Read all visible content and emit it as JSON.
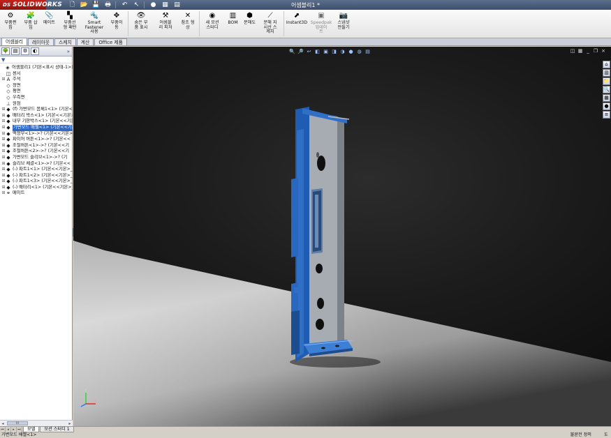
{
  "app": {
    "logo": "SOLIDWORKS",
    "logo_prefix": "DS",
    "doc_title": "어셈블리1 *"
  },
  "quick_access": [
    {
      "icon": "new-document-icon",
      "glyph": "🗋"
    },
    {
      "icon": "open-folder-icon",
      "glyph": "📂"
    },
    {
      "icon": "save-icon",
      "glyph": "💾"
    },
    {
      "icon": "print-icon",
      "glyph": "🖶"
    },
    {
      "icon": "undo-icon",
      "glyph": "↶"
    },
    {
      "icon": "select-arrow-icon",
      "glyph": "↖"
    },
    {
      "icon": "rebuild-icon",
      "glyph": "●"
    },
    {
      "icon": "file-properties-icon",
      "glyph": "▦"
    },
    {
      "icon": "options-icon",
      "glyph": "▤"
    }
  ],
  "ribbon": [
    {
      "id": "insert-component",
      "label": "부품편\n집",
      "icon": "component-edit-icon",
      "glyph": "⚙"
    },
    {
      "id": "insert-part",
      "label": "부품 삽\n입",
      "icon": "insert-component-icon",
      "glyph": "🧩"
    },
    {
      "id": "mate",
      "label": "메이트",
      "icon": "mate-icon",
      "glyph": "📎"
    },
    {
      "id": "linear-pattern",
      "label": "부품선\n형 패턴",
      "icon": "linear-pattern-icon",
      "glyph": "▚"
    },
    {
      "id": "smart-fastener",
      "label": "Smart\nFastener\n사용",
      "icon": "smart-fastener-icon",
      "glyph": "🔩"
    },
    {
      "id": "move-component",
      "label": "부품이\n동",
      "icon": "move-component-icon",
      "glyph": "✥"
    },
    {
      "id": "show-hidden",
      "label": "숨은 부\n품 표시",
      "icon": "show-hidden-icon",
      "glyph": "👁"
    },
    {
      "id": "assembly-features",
      "label": "어셈블\n리 피처",
      "icon": "assembly-feature-icon",
      "glyph": "⚒"
    },
    {
      "id": "reference-geometry",
      "label": "참조 형\n상",
      "icon": "reference-geometry-icon",
      "glyph": "✕"
    },
    {
      "id": "new-motion-study",
      "label": "새 모션\n스터디",
      "icon": "motion-study-icon",
      "glyph": "◉"
    },
    {
      "id": "bom",
      "label": "BOM",
      "icon": "bom-icon",
      "glyph": "▥"
    },
    {
      "id": "exploded-view",
      "label": "분해도",
      "icon": "exploded-view-icon",
      "glyph": "⬢"
    },
    {
      "id": "explode-line",
      "label": "분해 지\n시선 스\n케치",
      "icon": "explode-line-icon",
      "glyph": "⟋"
    },
    {
      "id": "instant3d",
      "label": "Instant3D",
      "icon": "instant3d-icon",
      "glyph": "⬈"
    },
    {
      "id": "speedpak",
      "label": "Speedpak\n업데이\n트",
      "icon": "speedpak-icon",
      "glyph": "▣",
      "disabled": true
    },
    {
      "id": "snapshot",
      "label": "스냅샷\n만들기",
      "icon": "snapshot-icon",
      "glyph": "📷"
    }
  ],
  "tabs": [
    {
      "label": "어셈블리",
      "active": true
    },
    {
      "label": "레이아웃",
      "active": false
    },
    {
      "label": "스케치",
      "active": false
    },
    {
      "label": "계산",
      "active": false
    },
    {
      "label": "Office 제품",
      "active": false
    }
  ],
  "feature_manager": {
    "tab_icons": [
      "feature-tree-icon",
      "property-manager-icon",
      "configuration-manager-icon",
      "display-manager-icon"
    ],
    "tab_glyphs": [
      "🌳",
      "▤",
      "⚙",
      "◐"
    ],
    "more": "»",
    "tree": [
      {
        "label": "어셈블리1  (기본<표시 상태-1>)",
        "icon": "assembly-icon",
        "glyph": "◈",
        "expand": "",
        "indent": 0
      },
      {
        "label": "센서",
        "icon": "sensor-icon",
        "glyph": "◫",
        "expand": "",
        "indent": 1
      },
      {
        "label": "주석",
        "icon": "annotation-icon",
        "glyph": "A",
        "expand": "⊞",
        "indent": 1
      },
      {
        "label": "정면",
        "icon": "plane-icon",
        "glyph": "◇",
        "expand": "",
        "indent": 1
      },
      {
        "label": "평면",
        "icon": "plane-icon",
        "glyph": "◇",
        "expand": "",
        "indent": 1
      },
      {
        "label": "우측면",
        "icon": "plane-icon",
        "glyph": "◇",
        "expand": "",
        "indent": 1
      },
      {
        "label": "원점",
        "icon": "origin-icon",
        "glyph": "⊥",
        "expand": "",
        "indent": 1
      },
      {
        "label": "(f) 가변모드 몸체1<1> (기본<<기본>_표시",
        "icon": "part-icon",
        "glyph": "◆",
        "expand": "⊞",
        "indent": 1
      },
      {
        "label": "배터리 박스<1> (기본<<기본>_표시",
        "icon": "part-icon",
        "glyph": "◆",
        "expand": "⊞",
        "indent": 1
      },
      {
        "label": "내부 기판박스<1> (기본<<기본>",
        "icon": "part-icon",
        "glyph": "◆",
        "expand": "⊞",
        "indent": 1
      },
      {
        "label": "가변모드 배젤<1> (기본<<기본>",
        "icon": "part-icon",
        "glyph": "◆",
        "expand": "⊞",
        "indent": 1,
        "selected": true
      },
      {
        "label": "액정부<1>->? (기본<<기본>_",
        "icon": "part-icon",
        "glyph": "◆",
        "expand": "⊞",
        "indent": 1
      },
      {
        "label": "파이어 버튼<1>->? (기본<<",
        "icon": "part-icon",
        "glyph": "◆",
        "expand": "⊞",
        "indent": 1
      },
      {
        "label": "조절버튼<1>->? (기본<<기",
        "icon": "part-icon",
        "glyph": "◆",
        "expand": "⊞",
        "indent": 1
      },
      {
        "label": "조절버튼<2>->? (기본<<기",
        "icon": "part-icon",
        "glyph": "◆",
        "expand": "⊞",
        "indent": 1
      },
      {
        "label": "가변모드 슬리브<1>->? (기",
        "icon": "part-icon",
        "glyph": "◆",
        "expand": "⊞",
        "indent": 1
      },
      {
        "label": "슬리브 체결<1>->? (기본<<",
        "icon": "part-icon",
        "glyph": "◆",
        "expand": "⊞",
        "indent": 1
      },
      {
        "label": "(-) 파트1<1> (기본<<기본>_",
        "icon": "part-icon",
        "glyph": "◆",
        "expand": "⊞",
        "indent": 1
      },
      {
        "label": "(-) 파트1<2> (기본<<기본>_",
        "icon": "part-icon",
        "glyph": "◆",
        "expand": "⊞",
        "indent": 1
      },
      {
        "label": "(-) 파트1<3> (기본<<기본>_",
        "icon": "part-icon",
        "glyph": "◆",
        "expand": "⊞",
        "indent": 1
      },
      {
        "label": "(-) 배터리<1> (기본<<기본>_표",
        "icon": "part-icon",
        "glyph": "◆",
        "expand": "⊞",
        "indent": 1
      },
      {
        "label": "메이트",
        "icon": "mates-folder-icon",
        "glyph": "⚭",
        "expand": "⊞",
        "indent": 1
      }
    ],
    "scroll_thumb": "III"
  },
  "viewport": {
    "heads_up": [
      {
        "icon": "zoom-to-fit-icon",
        "glyph": "🔍"
      },
      {
        "icon": "zoom-area-icon",
        "glyph": "🔎"
      },
      {
        "icon": "previous-view-icon",
        "glyph": "↩"
      },
      {
        "icon": "section-view-icon",
        "glyph": "◧"
      },
      {
        "icon": "view-orientation-icon",
        "glyph": "▣"
      },
      {
        "icon": "display-style-icon",
        "glyph": "◨"
      },
      {
        "icon": "hide-show-icon",
        "glyph": "◑"
      },
      {
        "icon": "edit-appearance-icon",
        "glyph": "●"
      },
      {
        "icon": "apply-scene-icon",
        "glyph": "◍"
      },
      {
        "icon": "view-settings-icon",
        "glyph": "▤"
      }
    ],
    "window_controls": [
      {
        "icon": "viewport-split-icon",
        "glyph": "◫"
      },
      {
        "icon": "viewport-tile-icon",
        "glyph": "▦"
      },
      {
        "icon": "minimize-icon",
        "glyph": "_"
      },
      {
        "icon": "restore-icon",
        "glyph": "❐"
      },
      {
        "icon": "close-icon",
        "glyph": "×"
      }
    ],
    "task_pane": [
      {
        "icon": "solidworks-resources-icon",
        "glyph": "⌂"
      },
      {
        "icon": "design-library-icon",
        "glyph": "▥"
      },
      {
        "icon": "file-explorer-icon",
        "glyph": "📁"
      },
      {
        "icon": "search-icon",
        "glyph": "🔍"
      },
      {
        "icon": "view-palette-icon",
        "glyph": "▦"
      },
      {
        "icon": "appearances-icon",
        "glyph": "●"
      },
      {
        "icon": "custom-properties-icon",
        "glyph": "≡"
      }
    ],
    "model_colors": {
      "blue": "#2f6fc6",
      "blue_dark": "#1c4d91",
      "gray_panel": "#9ea3ab",
      "floor_light": "#d9d9d9"
    },
    "triad_labels": {
      "y": "Y",
      "x": "X",
      "z": "Z"
    }
  },
  "bottom_tabs": [
    {
      "label": "모델",
      "active": true
    },
    {
      "label": "모션 스터디 1",
      "active": false
    }
  ],
  "status": {
    "left": "가변모드 배젤<1>",
    "right": "불완전 정의",
    "help": "도"
  }
}
